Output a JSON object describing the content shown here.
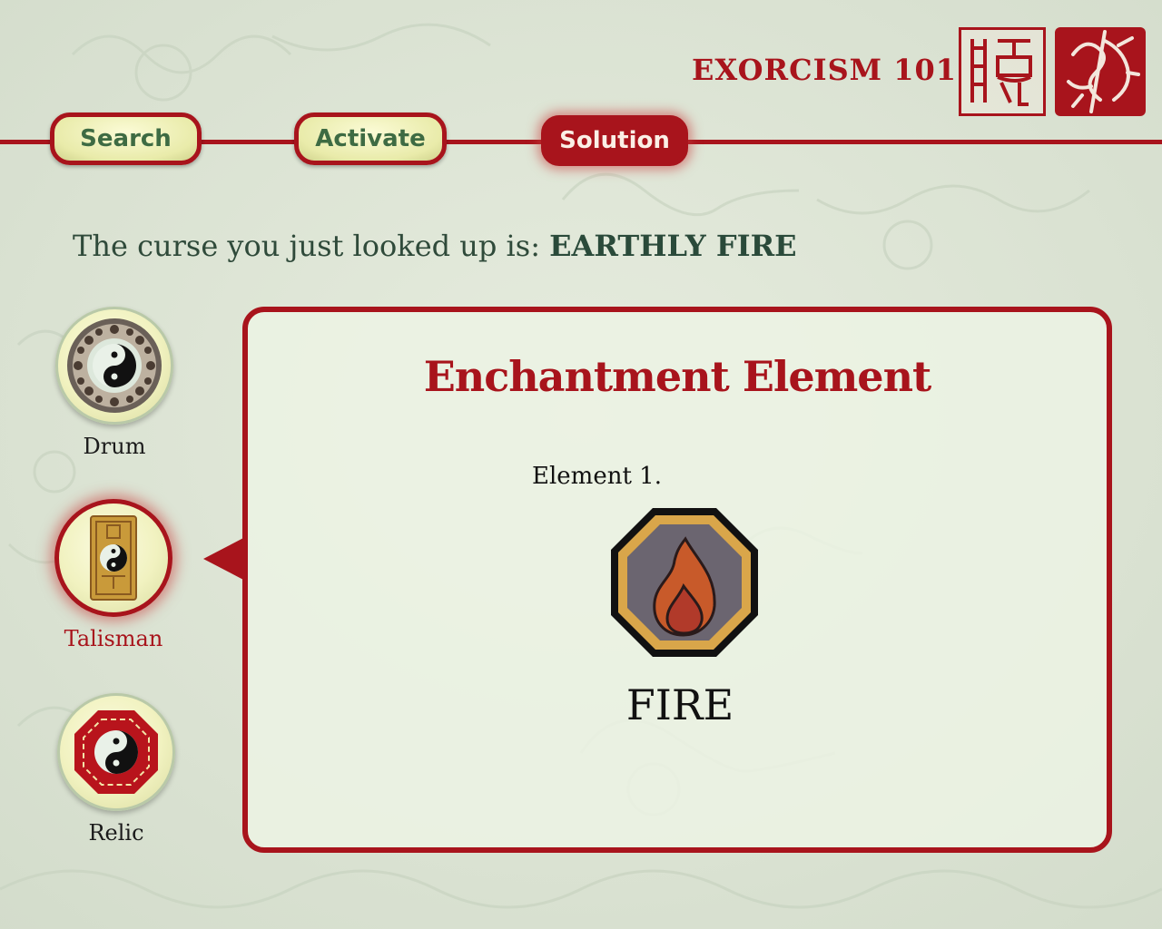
{
  "app": {
    "title": "EXORCISM 101"
  },
  "tabs": [
    {
      "label": "Search",
      "active": false
    },
    {
      "label": "Activate",
      "active": false
    },
    {
      "label": "Solution",
      "active": true
    }
  ],
  "curse": {
    "prefix": "The curse you just looked up is:",
    "name": "EARTHLY FIRE"
  },
  "nav": [
    {
      "label": "Drum",
      "icon": "drum-yin-yang-icon",
      "selected": false
    },
    {
      "label": "Talisman",
      "icon": "talisman-yin-yang-icon",
      "selected": true
    },
    {
      "label": "Relic",
      "icon": "bagua-mirror-icon",
      "selected": false
    }
  ],
  "panel": {
    "title": "Enchantment Element",
    "element_label": "Element 1.",
    "element_icon": "fire-element-icon",
    "element_name": "FIRE"
  },
  "colors": {
    "accent": "#a8141c",
    "background": "#dfe6d8",
    "tab_text": "#3e6b43",
    "fire_outer": "#c8532a",
    "fire_inner": "#b8392a"
  }
}
